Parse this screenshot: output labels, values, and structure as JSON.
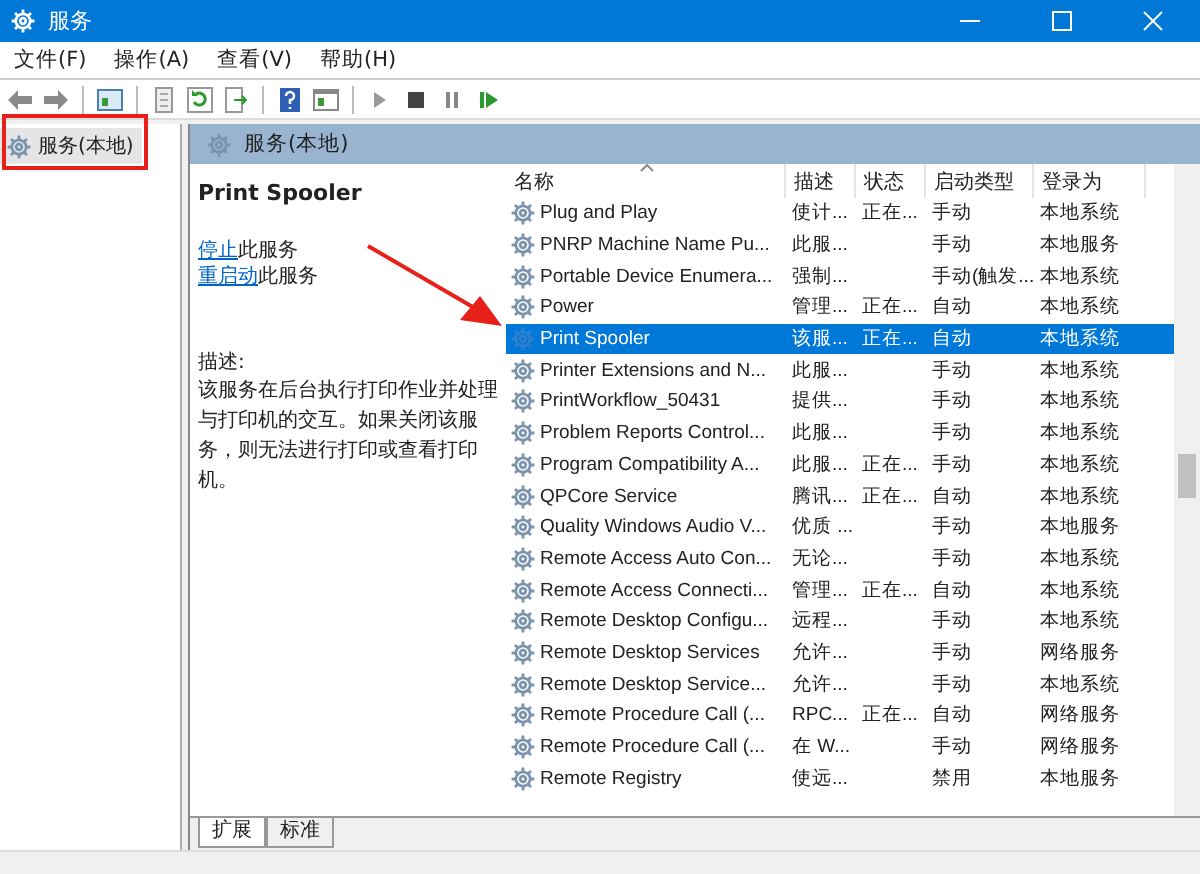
{
  "window": {
    "title": "服务"
  },
  "menu": [
    {
      "label": "文件(F)"
    },
    {
      "label": "操作(A)"
    },
    {
      "label": "查看(V)"
    },
    {
      "label": "帮助(H)"
    }
  ],
  "tree": [
    {
      "label": "服务(本地)",
      "selected": true
    }
  ],
  "panel": {
    "title": "服务(本地)",
    "service_name": "Print Spooler",
    "actions": [
      {
        "link": "停止",
        "text": "此服务"
      },
      {
        "link": "重启动",
        "text": "此服务"
      }
    ],
    "description_label": "描述:",
    "description": "该服务在后台执行打印作业并处理与打印机的交互。如果关闭该服务，则无法进行打印或查看打印机。"
  },
  "table": {
    "columns": [
      {
        "label": "名称",
        "sorted": true
      },
      {
        "label": "描述",
        "sorted": false
      },
      {
        "label": "状态",
        "sorted": false
      },
      {
        "label": "启动类型",
        "sorted": false
      },
      {
        "label": "登录为",
        "sorted": false
      }
    ],
    "rows": [
      {
        "cells": [
          "Plug and Play",
          "使计...",
          "正在...",
          "手动",
          "本地系统"
        ],
        "selected": false
      },
      {
        "cells": [
          "PNRP Machine Name Pu...",
          "此服...",
          "",
          "手动",
          "本地服务"
        ],
        "selected": false
      },
      {
        "cells": [
          "Portable Device Enumera...",
          "强制...",
          "",
          "手动(触发...",
          "本地系统"
        ],
        "selected": false
      },
      {
        "cells": [
          "Power",
          "管理...",
          "正在...",
          "自动",
          "本地系统"
        ],
        "selected": false
      },
      {
        "cells": [
          "Print Spooler",
          "该服...",
          "正在...",
          "自动",
          "本地系统"
        ],
        "selected": true
      },
      {
        "cells": [
          "Printer Extensions and N...",
          "此服...",
          "",
          "手动",
          "本地系统"
        ],
        "selected": false
      },
      {
        "cells": [
          "PrintWorkflow_50431",
          "提供...",
          "",
          "手动",
          "本地系统"
        ],
        "selected": false
      },
      {
        "cells": [
          "Problem Reports Control...",
          "此服...",
          "",
          "手动",
          "本地系统"
        ],
        "selected": false
      },
      {
        "cells": [
          "Program Compatibility A...",
          "此服...",
          "正在...",
          "手动",
          "本地系统"
        ],
        "selected": false
      },
      {
        "cells": [
          "QPCore Service",
          "腾讯...",
          "正在...",
          "自动",
          "本地系统"
        ],
        "selected": false
      },
      {
        "cells": [
          "Quality Windows Audio V...",
          "优质 ...",
          "",
          "手动",
          "本地服务"
        ],
        "selected": false
      },
      {
        "cells": [
          "Remote Access Auto Con...",
          "无论...",
          "",
          "手动",
          "本地系统"
        ],
        "selected": false
      },
      {
        "cells": [
          "Remote Access Connecti...",
          "管理...",
          "正在...",
          "自动",
          "本地系统"
        ],
        "selected": false
      },
      {
        "cells": [
          "Remote Desktop Configu...",
          "远程...",
          "",
          "手动",
          "本地系统"
        ],
        "selected": false
      },
      {
        "cells": [
          "Remote Desktop Services",
          "允许...",
          "",
          "手动",
          "网络服务"
        ],
        "selected": false
      },
      {
        "cells": [
          "Remote Desktop Service...",
          "允许...",
          "",
          "手动",
          "本地系统"
        ],
        "selected": false
      },
      {
        "cells": [
          "Remote Procedure Call (...",
          "RPC...",
          "正在...",
          "自动",
          "网络服务"
        ],
        "selected": false
      },
      {
        "cells": [
          "Remote Procedure Call (...",
          "在 W...",
          "",
          "手动",
          "网络服务"
        ],
        "selected": false
      },
      {
        "cells": [
          "Remote Registry",
          "使远...",
          "",
          "禁用",
          "本地服务"
        ],
        "selected": false
      }
    ]
  },
  "tabs": [
    {
      "label": "扩展",
      "selected": true
    },
    {
      "label": "标准",
      "selected": false
    }
  ]
}
